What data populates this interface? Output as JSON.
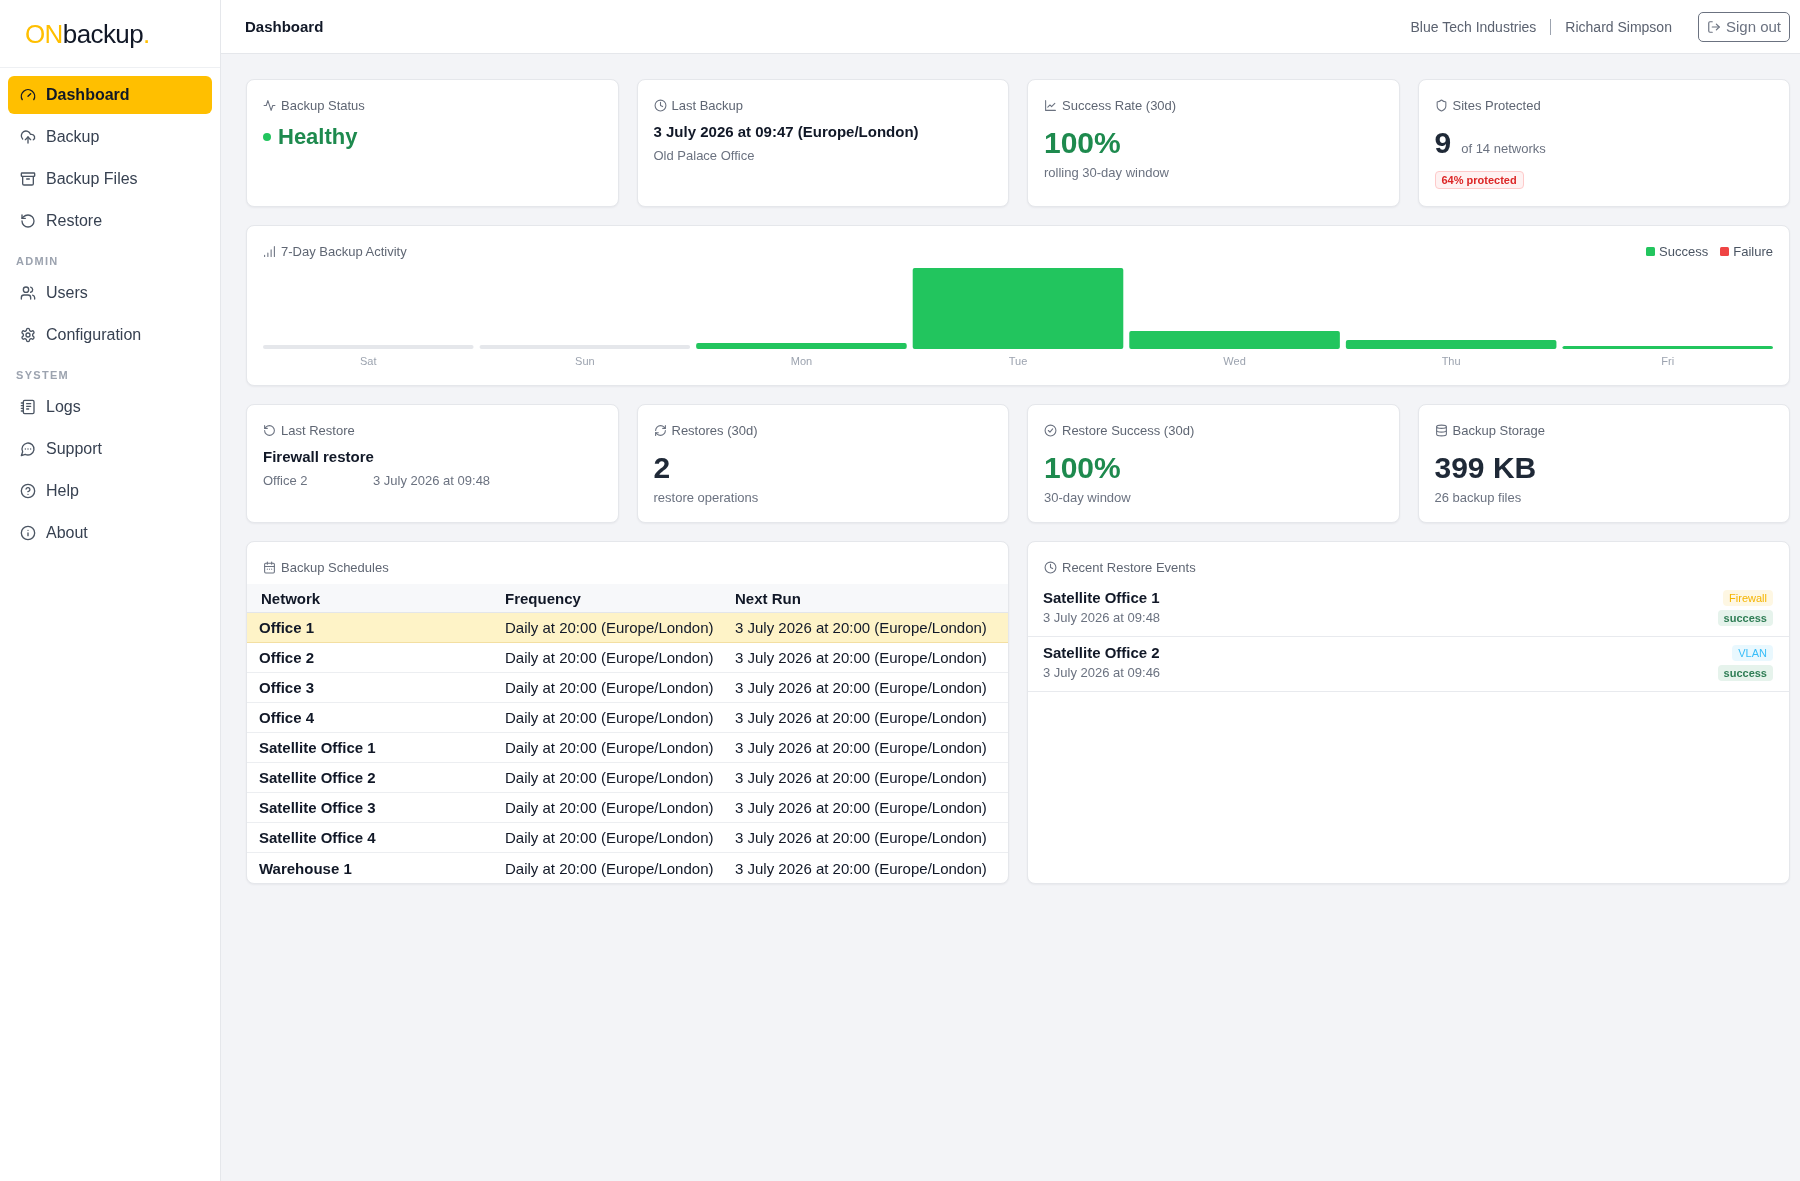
{
  "sidebar": {
    "logo": {
      "accent": "ON",
      "name": "backup",
      "dot": "."
    },
    "sections": [
      {
        "items": [
          {
            "label": "Dashboard",
            "selected": true
          },
          {
            "label": "Backup",
            "selected": false
          },
          {
            "label": "Backup Files",
            "selected": false
          },
          {
            "label": "Restore",
            "selected": false
          }
        ]
      },
      {
        "heading": "ADMIN",
        "items": [
          {
            "label": "Users",
            "selected": false
          },
          {
            "label": "Configuration",
            "selected": false
          }
        ]
      },
      {
        "heading": "SYSTEM",
        "items": [
          {
            "label": "Logs",
            "selected": false
          },
          {
            "label": "Support",
            "selected": false
          },
          {
            "label": "Help",
            "selected": false
          },
          {
            "label": "About",
            "selected": false
          }
        ]
      }
    ]
  },
  "header": {
    "title": "Dashboard",
    "organization": "Blue Tech Industries",
    "user": "Richard Simpson",
    "sign_out": "Sign out"
  },
  "summary_cards": [
    {
      "kind": "status",
      "title": "Backup Status",
      "value": "Healthy"
    },
    {
      "kind": "detail",
      "title": "Last Backup",
      "value": "3 July 2026 at 09:47 (Europe/London)",
      "caption": "Old Palace Office"
    },
    {
      "kind": "rate",
      "title": "Success Rate (30d)",
      "value": "100%",
      "caption": "rolling 30-day window"
    },
    {
      "kind": "count",
      "title": "Sites Protected",
      "value": "9",
      "unit": "of 14 networks",
      "badge": "64% protected"
    }
  ],
  "activity": {
    "title": "7-Day Backup Activity",
    "legend": [
      {
        "label": "Success",
        "color": "#22c55e"
      },
      {
        "label": "Failure",
        "color": "#ef4444"
      }
    ],
    "days": [
      "Sat",
      "Sun",
      "Mon",
      "Tue",
      "Wed",
      "Thu",
      "Fri"
    ]
  },
  "restore_cards": [
    {
      "kind": "restore",
      "title": "Last Restore",
      "value": "Firewall restore",
      "network": "Office 2",
      "time": "3 July 2026 at 09:48"
    },
    {
      "kind": "count",
      "title": "Restores (30d)",
      "value": "2",
      "caption": "restore operations"
    },
    {
      "kind": "rate",
      "title": "Restore Success (30d)",
      "value": "100%",
      "caption": "30-day window"
    },
    {
      "kind": "count",
      "title": "Backup Storage",
      "value": "399 KB",
      "caption": "26 backup files"
    }
  ],
  "schedules": {
    "title": "Backup Schedules",
    "columns": [
      "Network",
      "Frequency",
      "Next Run"
    ],
    "rows": [
      {
        "cells": [
          "Office 1",
          "Daily at 20:00 (Europe/London)",
          "3 July 2026 at 20:00 (Europe/London)"
        ],
        "selected": true
      },
      {
        "cells": [
          "Office 2",
          "Daily at 20:00 (Europe/London)",
          "3 July 2026 at 20:00 (Europe/London)"
        ],
        "selected": false
      },
      {
        "cells": [
          "Office 3",
          "Daily at 20:00 (Europe/London)",
          "3 July 2026 at 20:00 (Europe/London)"
        ],
        "selected": false
      },
      {
        "cells": [
          "Office 4",
          "Daily at 20:00 (Europe/London)",
          "3 July 2026 at 20:00 (Europe/London)"
        ],
        "selected": false
      },
      {
        "cells": [
          "Satellite Office 1",
          "Daily at 20:00 (Europe/London)",
          "3 July 2026 at 20:00 (Europe/London)"
        ],
        "selected": false
      },
      {
        "cells": [
          "Satellite Office 2",
          "Daily at 20:00 (Europe/London)",
          "3 July 2026 at 20:00 (Europe/London)"
        ],
        "selected": false
      },
      {
        "cells": [
          "Satellite Office 3",
          "Daily at 20:00 (Europe/London)",
          "3 July 2026 at 20:00 (Europe/London)"
        ],
        "selected": false
      },
      {
        "cells": [
          "Satellite Office 4",
          "Daily at 20:00 (Europe/London)",
          "3 July 2026 at 20:00 (Europe/London)"
        ],
        "selected": false
      },
      {
        "cells": [
          "Warehouse 1",
          "Daily at 20:00 (Europe/London)",
          "3 July 2026 at 20:00 (Europe/London)"
        ],
        "selected": false
      }
    ]
  },
  "restore_events": {
    "title": "Recent Restore Events",
    "items": [
      {
        "network": "Satellite Office 1",
        "time": "3 July 2026 at 09:48",
        "tag": {
          "label": "Firewall",
          "color": "#f5b400"
        },
        "status": "success"
      },
      {
        "network": "Satellite Office 2",
        "time": "3 July 2026 at 09:46",
        "tag": {
          "label": "VLAN",
          "color": "#38bdf8"
        },
        "status": "success"
      }
    ]
  }
}
